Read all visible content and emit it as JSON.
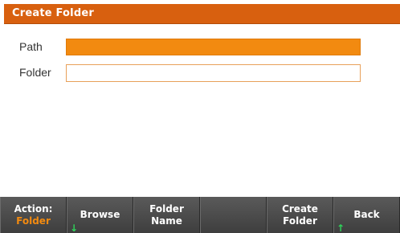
{
  "window": {
    "title": "Create Folder"
  },
  "form": {
    "path_label": "Path",
    "path_value": "",
    "folder_label": "Folder",
    "folder_value": ""
  },
  "softkeys": [
    {
      "line1": "Action:",
      "line2": "Folder",
      "arrow": ""
    },
    {
      "line1": "Browse",
      "line2": "",
      "arrow": "↓"
    },
    {
      "line1": "Folder",
      "line2": "Name",
      "arrow": ""
    },
    {
      "line1": "",
      "line2": "",
      "arrow": ""
    },
    {
      "line1": "Create",
      "line2": "Folder",
      "arrow": ""
    },
    {
      "line1": "Back",
      "line2": "",
      "arrow": "↑"
    }
  ],
  "colors": {
    "title_bar": "#d8600f",
    "selected_field": "#f28a10",
    "softkey_accent": "#f28a10",
    "arrow": "#2fd35a"
  }
}
